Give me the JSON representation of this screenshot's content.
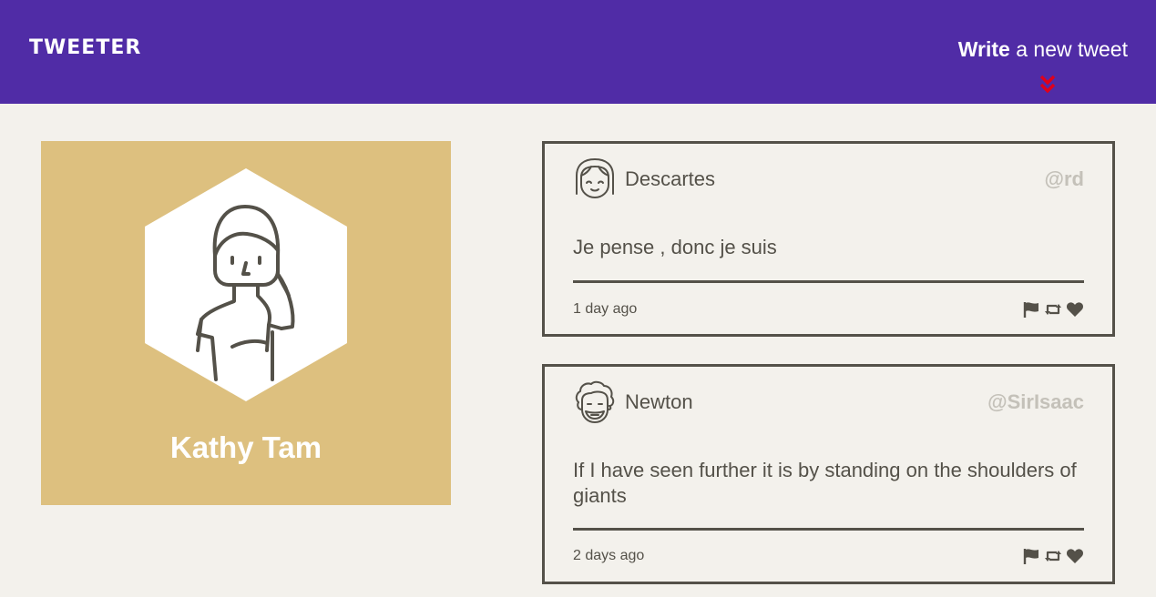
{
  "header": {
    "logo": "TWEETER",
    "compose_bold": "Write",
    "compose_rest": " a new tweet",
    "arrow_icon": "double-chevron-down-icon",
    "background": "#502ca6",
    "arrow_color": "#e0001b"
  },
  "profile": {
    "name": "Kathy Tam",
    "background": "#ddc07f",
    "avatar_icon": "woman-avatar-icon"
  },
  "tweets": [
    {
      "name": "Descartes",
      "handle": "@rd",
      "text": "Je pense , donc je suis",
      "time": "1 day ago",
      "avatar_icon": "girl-avatar-icon",
      "actions": [
        "flag-icon",
        "retweet-icon",
        "heart-icon"
      ]
    },
    {
      "name": "Newton",
      "handle": "@SirIsaac",
      "text": "If I have seen further it is by standing on the shoulders of giants",
      "time": "2 days ago",
      "avatar_icon": "curly-hair-avatar-icon",
      "actions": [
        "flag-icon",
        "retweet-icon",
        "heart-icon"
      ]
    }
  ]
}
